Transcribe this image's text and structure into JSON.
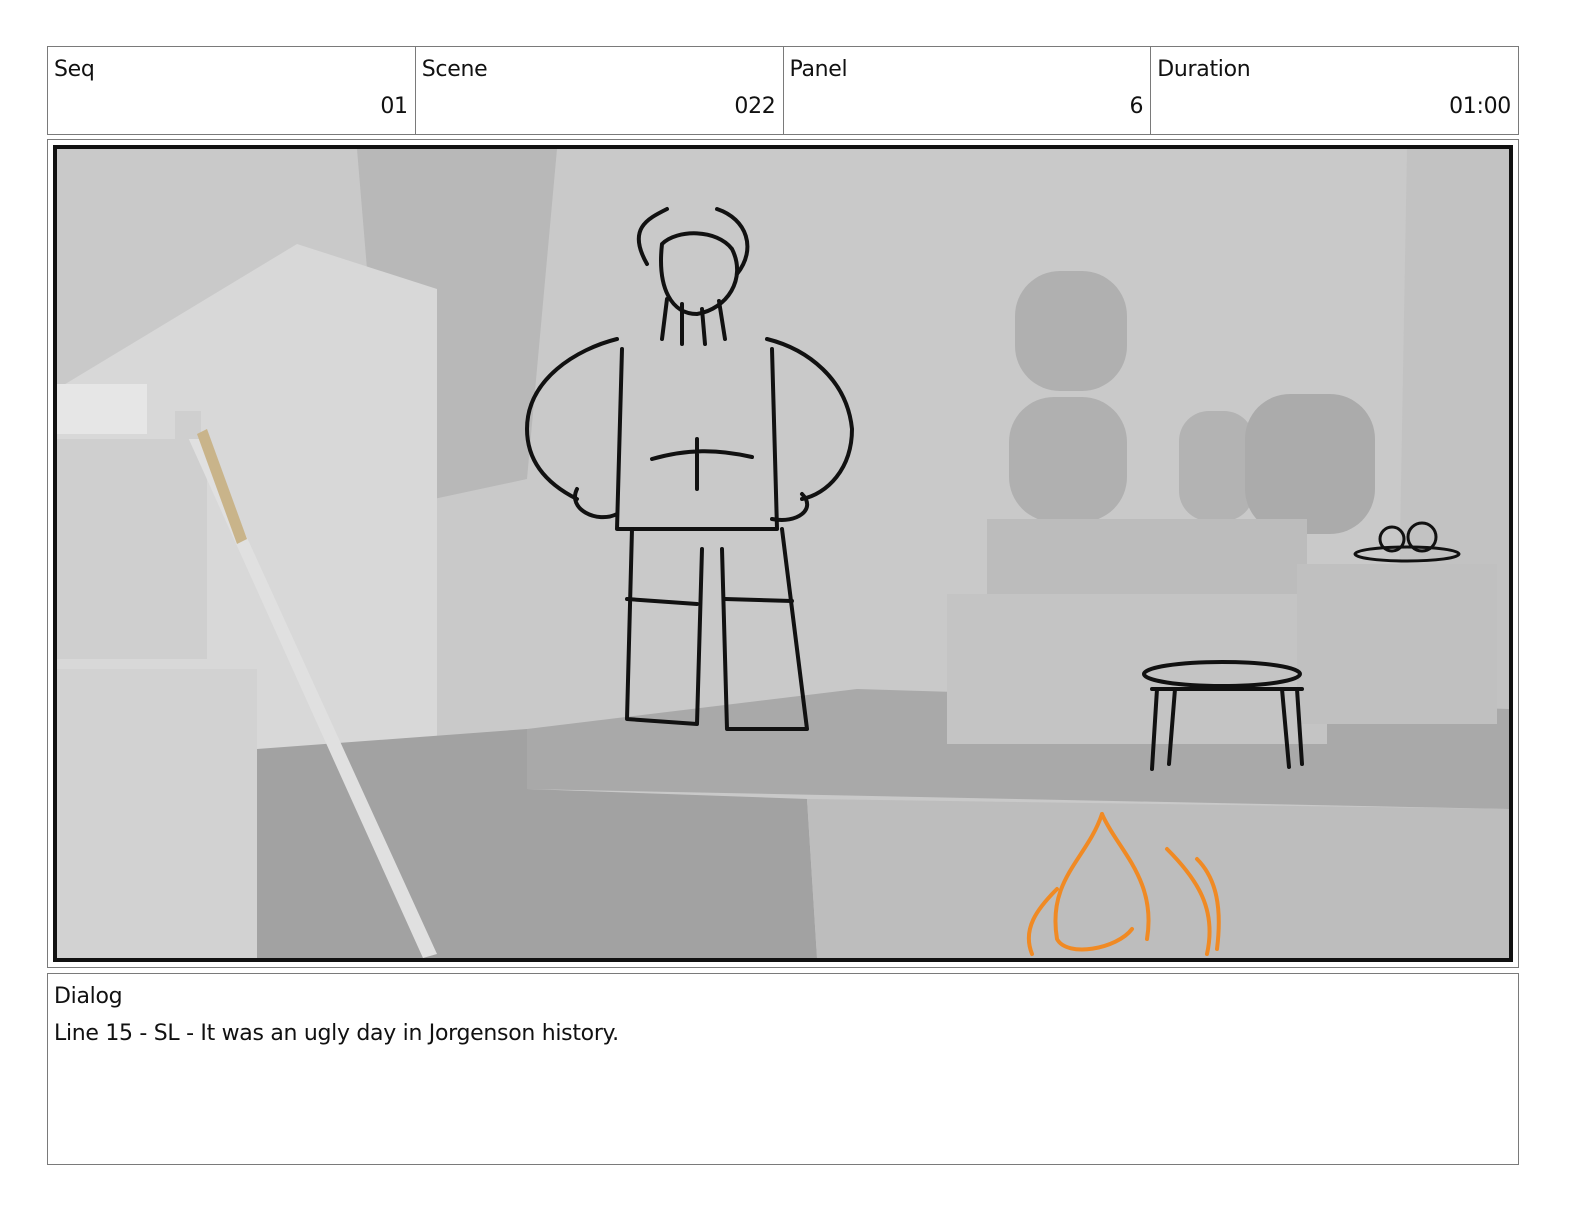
{
  "header": {
    "seq": {
      "label": "Seq",
      "value": "01"
    },
    "scene": {
      "label": "Scene",
      "value": "022"
    },
    "panel": {
      "label": "Panel",
      "value": "6"
    },
    "duration": {
      "label": "Duration",
      "value": "01:00"
    }
  },
  "dialog": {
    "label": "Dialog",
    "text": "Line 15 - SL - It was an ugly day in Jorgenson history."
  },
  "colors": {
    "background": "#c8c8c8",
    "sketch_line": "#111111",
    "fire": "#f08a24",
    "border": "#7a7a7a"
  },
  "icons": [
    "storyboard-sketch-image"
  ]
}
